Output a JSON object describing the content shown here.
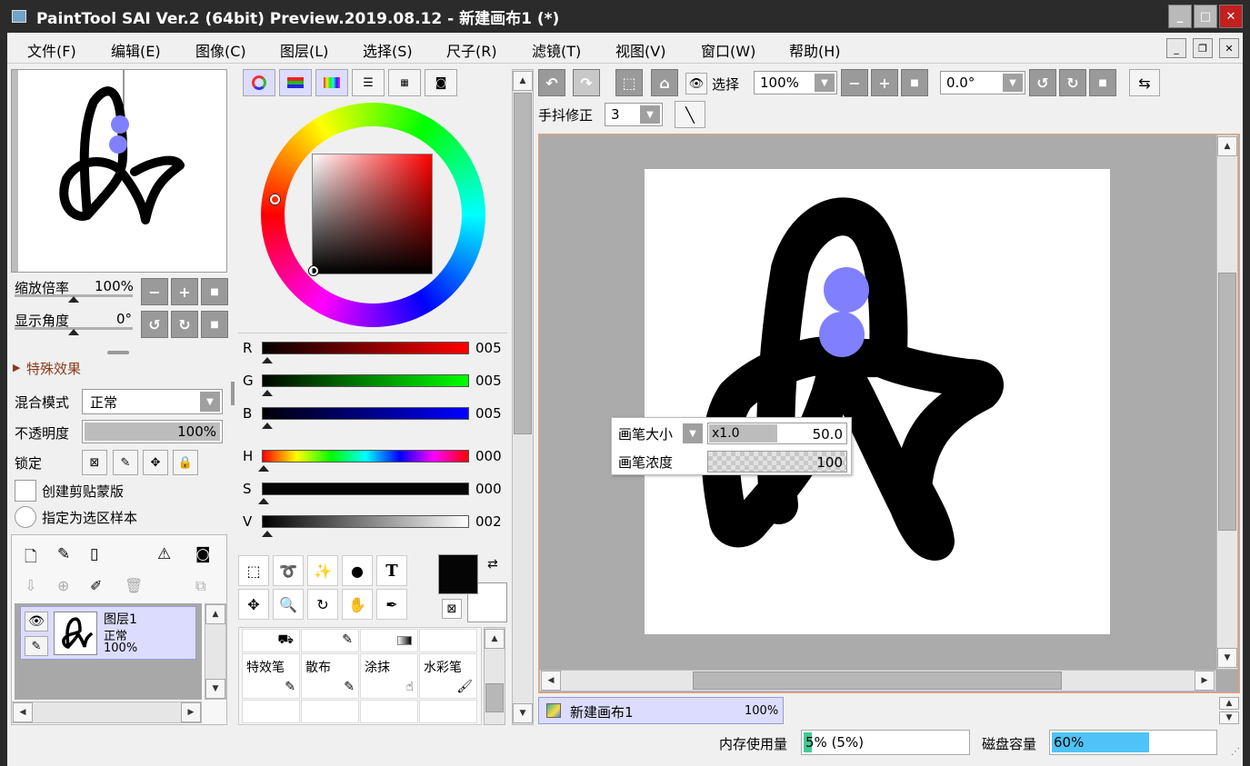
{
  "window": {
    "title": "PaintTool SAI Ver.2 (64bit) Preview.2019.08.12 - 新建画布1 (*)",
    "minimize": "_",
    "maximize": "□",
    "close": "✕"
  },
  "menu": [
    "文件(F)",
    "编辑(E)",
    "图像(C)",
    "图层(L)",
    "选择(S)",
    "尺子(R)",
    "滤镜(T)",
    "视图(V)",
    "窗口(W)",
    "帮助(H)"
  ],
  "navigator": {
    "zoom_label": "缩放倍率",
    "zoom_value": "100%",
    "angle_label": "显示角度",
    "angle_value": "0°"
  },
  "effects": {
    "label": "特殊效果"
  },
  "layer_props": {
    "blend_label": "混合模式",
    "blend_value": "正常",
    "opacity_label": "不透明度",
    "opacity_value": "100%",
    "lock_label": "锁定",
    "clip_label": "创建剪贴蒙版",
    "sample_label": "指定为选区样本"
  },
  "layers": [
    {
      "name": "图层1",
      "mode": "正常",
      "opacity": "100%"
    }
  ],
  "color": {
    "r_label": "R",
    "r_value": "005",
    "g_label": "G",
    "g_value": "005",
    "b_label": "B",
    "b_value": "005",
    "h_label": "H",
    "h_value": "000",
    "s_label": "S",
    "s_value": "000",
    "v_label": "V",
    "v_value": "002",
    "fg": "#050505",
    "bg": "#ffffff"
  },
  "brushes": [
    "特效笔",
    "散布",
    "涂抹",
    "水彩笔"
  ],
  "toolbar": {
    "select_label": "选择",
    "zoom_value": "100%",
    "angle_value": "0.0°",
    "stabilizer_label": "手抖修正",
    "stabilizer_value": "3"
  },
  "brush_popup": {
    "size_label": "画笔大小",
    "size_mult": "x1.0",
    "size_value": "50.0",
    "density_label": "画笔浓度",
    "density_value": "100"
  },
  "canvas_tab": {
    "name": "新建画布1",
    "zoom": "100%"
  },
  "status": {
    "memory_label": "内存使用量",
    "memory_value": "5% (5%)",
    "memory_fraction": 0.05,
    "disk_label": "磁盘容量",
    "disk_value": "60%",
    "disk_fraction": 0.6
  },
  "colors": {
    "accent": "#4fc3f7",
    "selection": "#dcdcff",
    "canvas_border": "#f0a070"
  }
}
